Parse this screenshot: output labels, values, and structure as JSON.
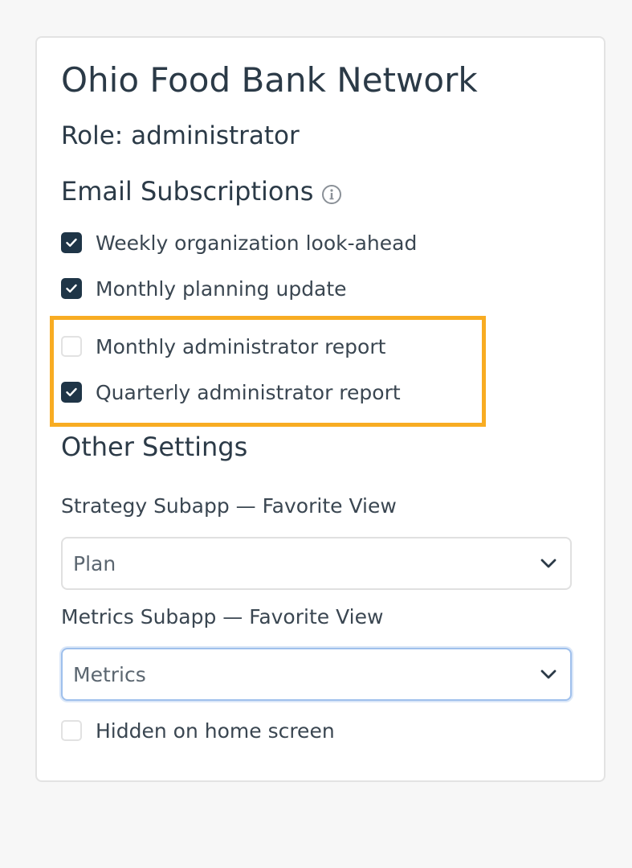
{
  "organization": {
    "name": "Ohio Food Bank Network"
  },
  "role": {
    "text": "Role: administrator"
  },
  "email_subscriptions": {
    "heading": "Email Subscriptions",
    "info_icon": "info-circle-icon",
    "items": [
      {
        "label": "Weekly organization look-ahead",
        "checked": true
      },
      {
        "label": "Monthly planning update",
        "checked": true
      },
      {
        "label": "Monthly administrator report",
        "checked": false
      },
      {
        "label": "Quarterly administrator report",
        "checked": true
      }
    ],
    "highlight_color": "#f8ac22"
  },
  "other_settings": {
    "heading": "Other Settings",
    "strategy": {
      "label": "Strategy Subapp — Favorite View",
      "value": "Plan"
    },
    "metrics": {
      "label": "Metrics Subapp — Favorite View",
      "value": "Metrics"
    },
    "hidden_home": {
      "label": "Hidden on home screen",
      "checked": false
    }
  },
  "colors": {
    "checkbox_checked": "#1f3547",
    "text": "#2b3a47",
    "focus_border": "#9fc0ec"
  }
}
